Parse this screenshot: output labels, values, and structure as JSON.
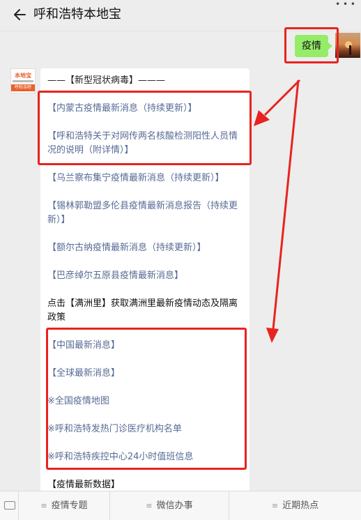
{
  "header": {
    "back_icon": "arrow-left-icon",
    "title": "呼和浩特本地宝",
    "more_icon": "more-dots-icon"
  },
  "outgoing_message": {
    "text": "疫情"
  },
  "account_avatar": {
    "logo_top": "本地宝",
    "logo_bar": "呼和浩特"
  },
  "incoming_message": {
    "heading": "——【新型冠状病毒】———",
    "links": [
      "【内蒙古疫情最新消息（持续更新）】",
      "【呼和浩特关于对网传两名核酸检测阳性人员情况的说明（附详情）】",
      "【乌兰察布集宁疫情最新消息（持续更新）】",
      "【锡林郭勒盟多伦县疫情最新消息报告（持续更新）】",
      "【额尔古纳疫情最新消息（持续更新）】",
      "【巴彦绰尔五原县疫情最新消息】"
    ],
    "manzhouli_note": "点击【满洲里】获取满洲里最新疫情动态及隔离政策",
    "more_links": [
      "【中国最新消息】",
      "【全球最新消息】",
      "※全国疫情地图",
      "※呼和浩特发热门诊医疗机构名单",
      "※呼和浩特疾控中心24小时值班信息"
    ],
    "data_heading": "【疫情最新数据】"
  },
  "annotation_colors": {
    "highlight_red": "#e8231f"
  },
  "tabbar": {
    "keyboard_icon": "keyboard-icon",
    "tabs": [
      "疫情专题",
      "微信办事",
      "近期热点"
    ],
    "menu_glyph": "≡"
  }
}
